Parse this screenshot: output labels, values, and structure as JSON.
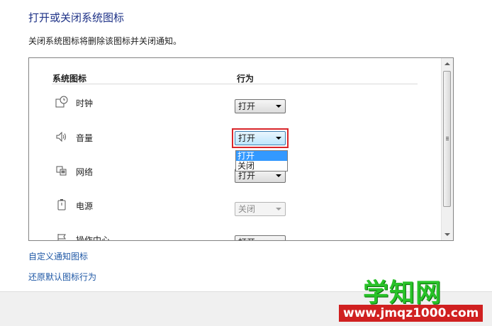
{
  "title": "打开或关闭系统图标",
  "subtitle": "关闭系统图标将删除该图标并关闭通知。",
  "table": {
    "col_icon": "系统图标",
    "col_behavior": "行为",
    "rows": [
      {
        "icon": "clock-icon",
        "label": "时钟",
        "value": "打开",
        "disabled": false
      },
      {
        "icon": "speaker-icon",
        "label": "音量",
        "value": "打开",
        "disabled": false
      },
      {
        "icon": "network-icon",
        "label": "网络",
        "value": "打开",
        "disabled": false
      },
      {
        "icon": "power-icon",
        "label": "电源",
        "value": "关闭",
        "disabled": true
      },
      {
        "icon": "action-center-flag-icon",
        "label": "操作中心",
        "value": "打开",
        "disabled": false
      }
    ]
  },
  "dropdown": {
    "options": [
      "打开",
      "关闭"
    ],
    "selected": "打开"
  },
  "links": {
    "customize": "自定义通知图标",
    "restore": "还原默认图标行为"
  },
  "watermark": {
    "main": "学知网",
    "url": "www.jmqz1000.com"
  },
  "colors": {
    "title": "#1e3287",
    "link": "#1e57a5",
    "highlight_box": "#d9262a",
    "selection": "#3399ff"
  }
}
